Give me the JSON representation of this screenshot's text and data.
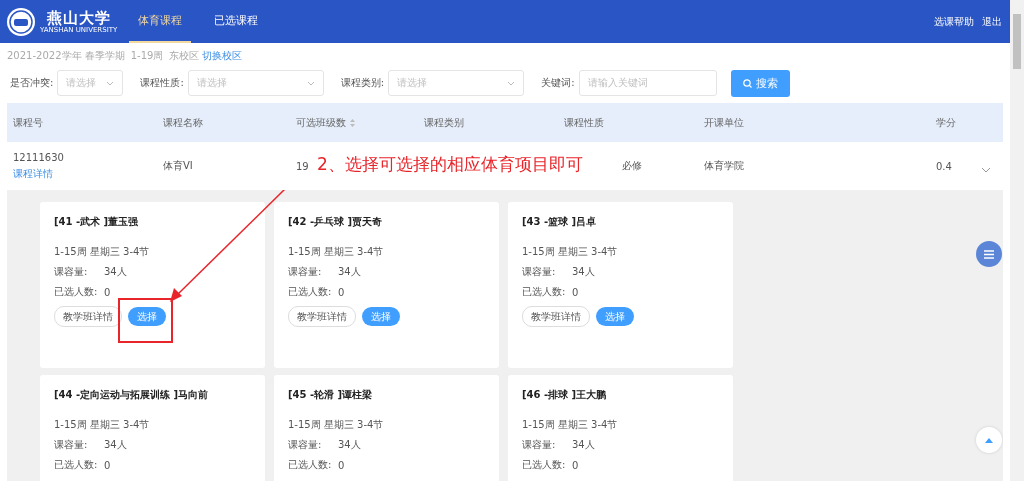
{
  "header": {
    "logo_text": "燕山大学",
    "logo_subtext": "YANSHAN UNIVERSITY",
    "tabs": [
      {
        "label": "体育课程",
        "selected": true
      },
      {
        "label": "已选课程",
        "selected": false
      }
    ],
    "links": [
      "选课帮助",
      "退出"
    ]
  },
  "term_info": {
    "year_term": "2021-2022学年 春季学期",
    "weeks": "1-19周",
    "campus": "东校区",
    "switch_link": "切换校区"
  },
  "filters": [
    {
      "kind": "select",
      "label": "是否冲突:",
      "placeholder": "请选择"
    },
    {
      "kind": "select",
      "label": "课程性质:",
      "placeholder": "请选择"
    },
    {
      "kind": "select",
      "label": "课程类别:",
      "placeholder": "请选择"
    },
    {
      "kind": "input",
      "label": "关键词:",
      "placeholder": "请输入关键词"
    }
  ],
  "search_button": "搜索",
  "table": {
    "columns": [
      {
        "label": "课程号",
        "sortable": false
      },
      {
        "label": "课程名称",
        "sortable": false
      },
      {
        "label": "可选班级数",
        "sortable": true
      },
      {
        "label": "课程类别",
        "sortable": false
      },
      {
        "label": "课程性质",
        "sortable": false
      },
      {
        "label": "开课单位",
        "sortable": false
      },
      {
        "label": "学分",
        "sortable": false
      }
    ],
    "row": {
      "course_no": "12111630",
      "detail_link": "课程详情",
      "name": "体育VI",
      "class_count": "19",
      "nature": "必修",
      "unit": "体育学院",
      "credit": "0.4"
    }
  },
  "annotation": "2、选择可选择的相应体育项目即可",
  "cards": [
    {
      "title": "[41 -武术 ]董玉强",
      "schedule": "1-15周 星期三 3-4节",
      "capacity_label": "课容量:",
      "capacity": "34人",
      "enrolled_label": "已选人数:",
      "enrolled": "0",
      "detail_button": "教学班详情",
      "select_button": "选择",
      "highlighted": true
    },
    {
      "title": "[42 -乒乓球 ]贾天奇",
      "schedule": "1-15周 星期三 3-4节",
      "capacity_label": "课容量:",
      "capacity": "34人",
      "enrolled_label": "已选人数:",
      "enrolled": "0",
      "detail_button": "教学班详情",
      "select_button": "选择",
      "highlighted": false
    },
    {
      "title": "[43 -篮球 ]吕卓",
      "schedule": "1-15周 星期三 3-4节",
      "capacity_label": "课容量:",
      "capacity": "34人",
      "enrolled_label": "已选人数:",
      "enrolled": "0",
      "detail_button": "教学班详情",
      "select_button": "选择",
      "highlighted": false
    },
    {
      "title": "[44 -定向运动与拓展训练 ]马向前",
      "schedule": "1-15周 星期三 3-4节",
      "capacity_label": "课容量:",
      "capacity": "34人",
      "enrolled_label": "已选人数:",
      "enrolled": "0",
      "highlighted": false
    },
    {
      "title": "[45 -轮滑 ]谭柱梁",
      "schedule": "1-15周 星期三 3-4节",
      "capacity_label": "课容量:",
      "capacity": "34人",
      "enrolled_label": "已选人数:",
      "enrolled": "0",
      "highlighted": false
    },
    {
      "title": "[46 -排球 ]王大鹏",
      "schedule": "1-15周 星期三 3-4节",
      "capacity_label": "课容量:",
      "capacity": "34人",
      "enrolled_label": "已选人数:",
      "enrolled": "0",
      "highlighted": false
    }
  ]
}
